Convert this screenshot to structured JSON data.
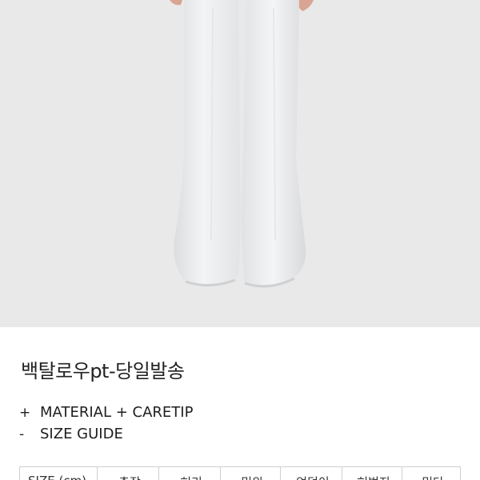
{
  "product": {
    "title": "백탈로우pt-당일발송",
    "image_alt": "product-photo-white-flared-pants"
  },
  "details": {
    "material_sign": "+",
    "material_label": "MATERIAL + CARETIP",
    "size_sign": "-",
    "size_label": "SIZE GUIDE"
  },
  "size_table": {
    "headers": [
      "SIZE (cm)",
      "총장",
      "허리",
      "밑위",
      "엉덩이",
      "허벅지",
      "밑단"
    ]
  },
  "colors": {
    "hero_background": "#e9e9e9",
    "pants": "#ebecee",
    "text": "#222222",
    "table_border": "#cfcfcf"
  }
}
